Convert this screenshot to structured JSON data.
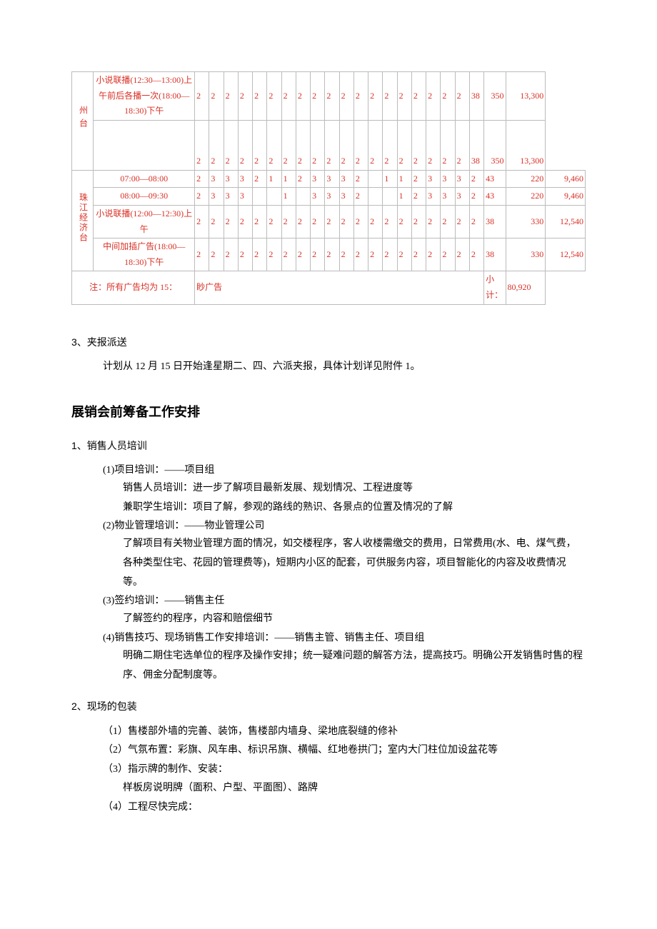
{
  "table": {
    "station1": "州\n\n台",
    "station2": "珠江经济台",
    "rows": [
      {
        "prog": "小说联播(12:30—13:00)上午前后各播一次(18:00—18:30)下午",
        "d": [
          "2",
          "2",
          "2",
          "2",
          "2",
          "2",
          "2",
          "2",
          "2",
          "2",
          "2",
          "2",
          "2",
          "2",
          "2",
          "2",
          "2",
          "2",
          "2"
        ],
        "total": "38",
        "unit": "350",
        "sum": "13,300",
        "merged": true
      },
      {
        "prog": "",
        "d": [
          "2",
          "2",
          "2",
          "2",
          "2",
          "2",
          "2",
          "2",
          "2",
          "2",
          "2",
          "2",
          "2",
          "2",
          "2",
          "2",
          "2",
          "2",
          "2"
        ],
        "total": "38",
        "unit": "350",
        "sum": "13,300"
      },
      {
        "prog": "07:00—08:00",
        "d": [
          "2",
          "3",
          "3",
          "3",
          "2",
          "1",
          "1",
          "2",
          "3",
          "3",
          "3",
          "2",
          "",
          "1",
          "1",
          "2",
          "3",
          "3",
          "3",
          "2"
        ],
        "total": "43",
        "unit": "220",
        "sum": "9,460"
      },
      {
        "prog": "08:00—09:30",
        "d": [
          "2",
          "3",
          "3",
          "3",
          "",
          "",
          "1",
          "",
          "3",
          "3",
          "3",
          "2",
          "",
          "",
          "1",
          "2",
          "3",
          "3",
          "3",
          "2"
        ],
        "total": "43",
        "unit": "220",
        "sum": "9,460"
      },
      {
        "prog": "小说联播(12:00—12:30)上午",
        "d": [
          "2",
          "2",
          "2",
          "2",
          "2",
          "2",
          "2",
          "2",
          "2",
          "2",
          "2",
          "2",
          "2",
          "2",
          "2",
          "2",
          "2",
          "2",
          "2",
          "2"
        ],
        "total": "38",
        "unit": "330",
        "sum": "12,540"
      },
      {
        "prog": "中间加插广告(18:00—18:30)下午",
        "d": [
          "2",
          "2",
          "2",
          "2",
          "2",
          "2",
          "2",
          "2",
          "2",
          "2",
          "2",
          "2",
          "2",
          "2",
          "2",
          "2",
          "2",
          "2",
          "2",
          "2"
        ],
        "total": "38",
        "unit": "330",
        "sum": "12,540"
      }
    ],
    "note_left": "注：所有广告均为 15：",
    "note_right": "眇广告",
    "subtotal_label": "小计：",
    "subtotal_value": "80,920"
  },
  "sec3": {
    "no": "3",
    "title": "、夹报派送",
    "body": "计划从 12 月 15 日开始逢星期二、四、六派夹报，具体计划详见附件 1。"
  },
  "h2": "展销会前筹备工作安排",
  "s1": {
    "no": "1",
    "title": "、销售人员培训",
    "i1": "(1)项目培训：——项目组",
    "i1a": "销售人员培训：进一步了解项目最新发展、规划情况、工程进度等",
    "i1b": "兼职学生培训：项目了解，参观的路线的熟识、各景点的位置及情况的了解",
    "i2": "(2)物业管理培训：——物业管理公司",
    "i2a": "了解项目有关物业管理方面的情况，如交楼程序，客人收楼需缴交的费用，日常费用(水、电、煤气费，各种类型住宅、花园的管理费等)，短期内小区的配套，可供服务内容，项目智能化的内容及收费情况等。",
    "i3": "(3)签约培训：——销售主任",
    "i3a": "了解签约的程序，内容和赔偿细节",
    "i4": "(4)销售技巧、现场销售工作安排培训：——销售主管、销售主任、项目组",
    "i4a": "明确二期住宅选单位的程序及操作安排；统一疑难问题的解答方法，提高技巧。明确公开发销售时售的程序、佣金分配制度等。"
  },
  "s2": {
    "no": "2",
    "title": "、现场的包装",
    "i1": "（1）售楼部外墙的完善、装饰，售楼部内墙身、梁地底裂缝的修补",
    "i2": "（2）气氛布置：彩旗、风车串、标识吊旗、横幅、红地卷拱门；室内大门柱位加设盆花等",
    "i3": "（3）指示牌的制作、安装：",
    "i3a": "样板房说明牌（面积、户型、平面图）、路牌",
    "i4": "（4）工程尽快完成："
  }
}
